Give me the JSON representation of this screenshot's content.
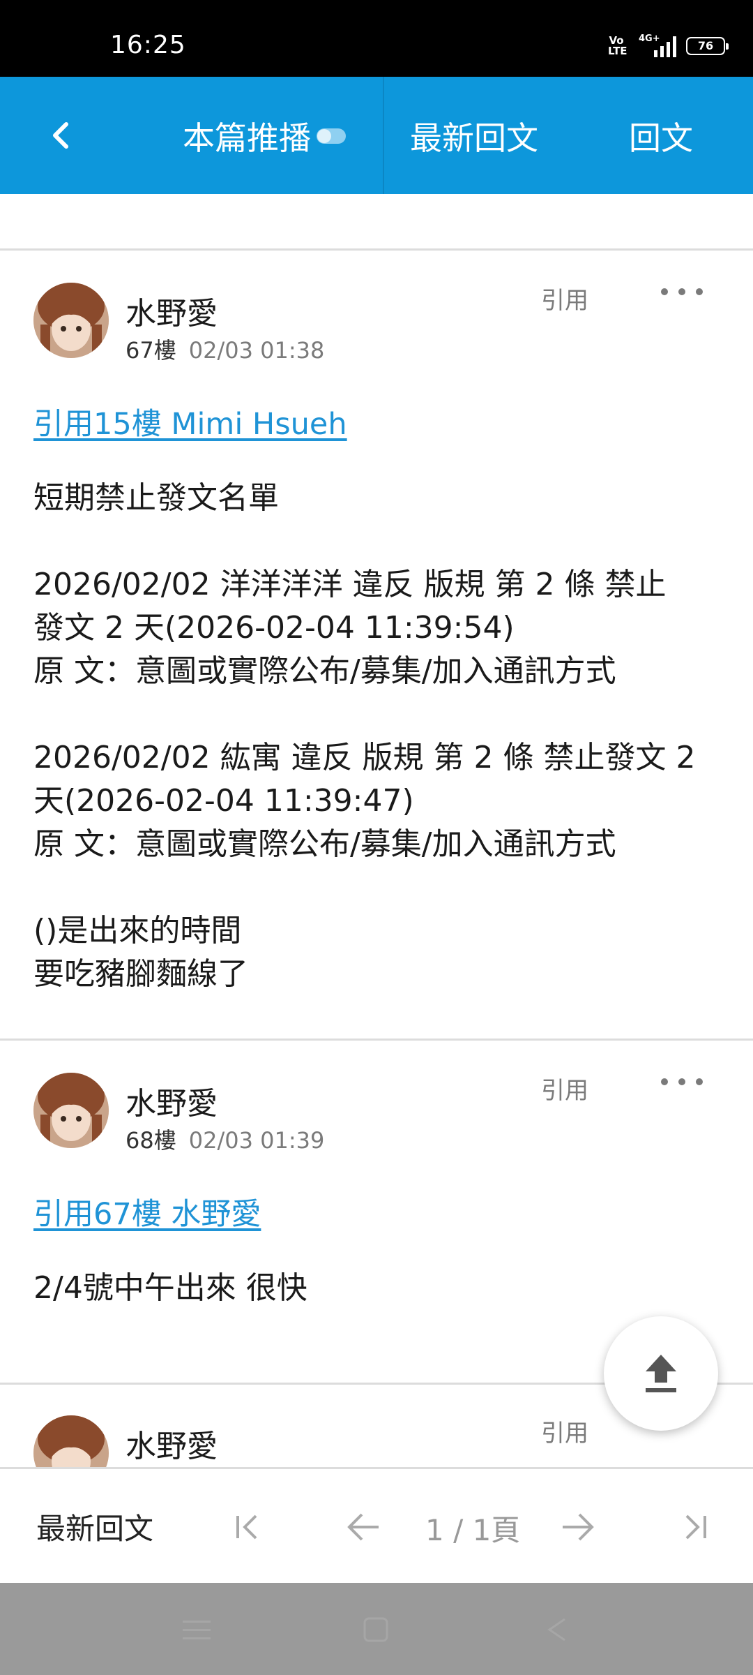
{
  "status_bar": {
    "time": "16:25",
    "volte": "Vo LTE",
    "network": "4G+",
    "battery": "76"
  },
  "app_bar": {
    "tab_push": "本篇推播",
    "tab_latest": "最新回文",
    "tab_reply": "回文"
  },
  "posts": [
    {
      "author": "水野愛",
      "floor": "67樓",
      "time": "02/03 01:38",
      "quote_action": "引用",
      "quote_link": "引用15樓 Mimi Hsueh",
      "body": "短期禁止發文名單\n\n2026/02/02 洋洋洋洋 違反 版規 第 2 條 禁止\n發文 2 天(2026-02-04 11:39:54)\n原 文：意圖或實際公布/募集/加入通訊方式\n\n2026/02/02 紘寓 違反 版規 第 2 條 禁止發文 2\n天(2026-02-04 11:39:47)\n原 文：意圖或實際公布/募集/加入通訊方式\n\n()是出來的時間\n要吃豬腳麵線了"
    },
    {
      "author": "水野愛",
      "floor": "68樓",
      "time": "02/03 01:39",
      "quote_action": "引用",
      "quote_link": "引用67樓 水野愛",
      "body": "2/4號中午出來 很快"
    },
    {
      "author": "水野愛",
      "quote_action": "引用"
    }
  ],
  "bottom_bar": {
    "latest_label": "最新回文",
    "page_indicator": "1 / 1頁"
  }
}
